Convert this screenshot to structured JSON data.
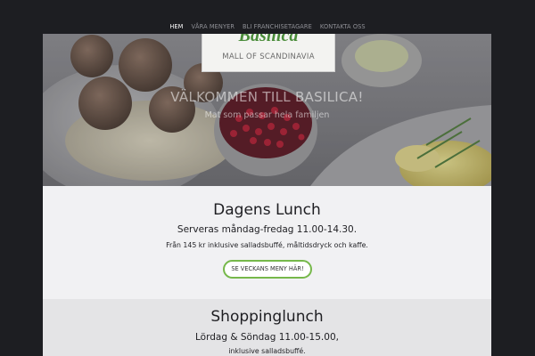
{
  "nav": {
    "items": [
      {
        "label": "HEM",
        "active": true
      },
      {
        "label": "VÅRA MENYER",
        "active": false
      },
      {
        "label": "BLI FRANCHISETAGARE",
        "active": false
      },
      {
        "label": "KONTAKTA OSS",
        "active": false
      }
    ]
  },
  "hero": {
    "logo_word": "Basilica",
    "logo_sub": "MALL OF SCANDINAVIA",
    "title": "VÄLKOMMEN TILL BASILICA!",
    "subtitle": "Mat som passar hela familjen"
  },
  "lunch": {
    "title": "Dagens Lunch",
    "hours": "Serveras måndag-fredag 11.00-14.30.",
    "price": "Från 145 kr inklusive salladsbuffé, måltidsdryck och kaffe.",
    "button_label": "SE VECKANS MENY HÄR!"
  },
  "shopping": {
    "title": "Shoppinglunch",
    "hours": "Lördag & Söndag 11.00-15.00,",
    "detail": "inklusive salladsbuffé."
  },
  "colors": {
    "background": "#1d1e22",
    "accent_green": "#76b84a",
    "brand_green": "#4a8c3a"
  }
}
